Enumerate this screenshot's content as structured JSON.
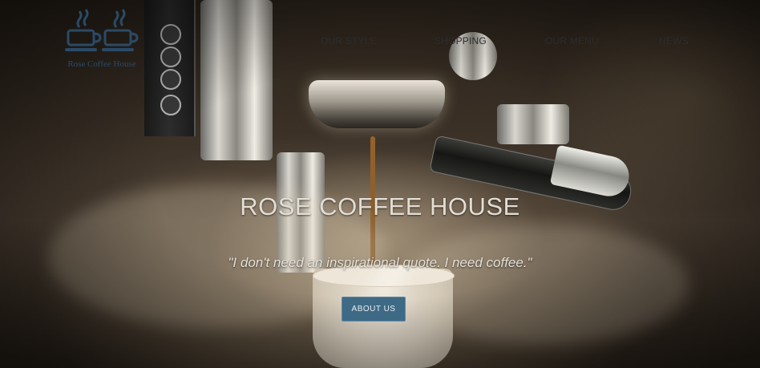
{
  "brand": {
    "logo_text": "Rose Coffee House",
    "logo_icon": "coffee-cups-icon",
    "logo_color": "#2a4a66"
  },
  "nav": {
    "items": [
      "OUR STYLE",
      "SHOPPING",
      "OUR MENU",
      "NEWS"
    ]
  },
  "hero": {
    "title": "ROSE COFFEE HOUSE",
    "quote": "\"I don't need an inspirational quote. I need coffee.\"",
    "button_label": "ABOUT US",
    "button_color": "#3e6a86"
  }
}
